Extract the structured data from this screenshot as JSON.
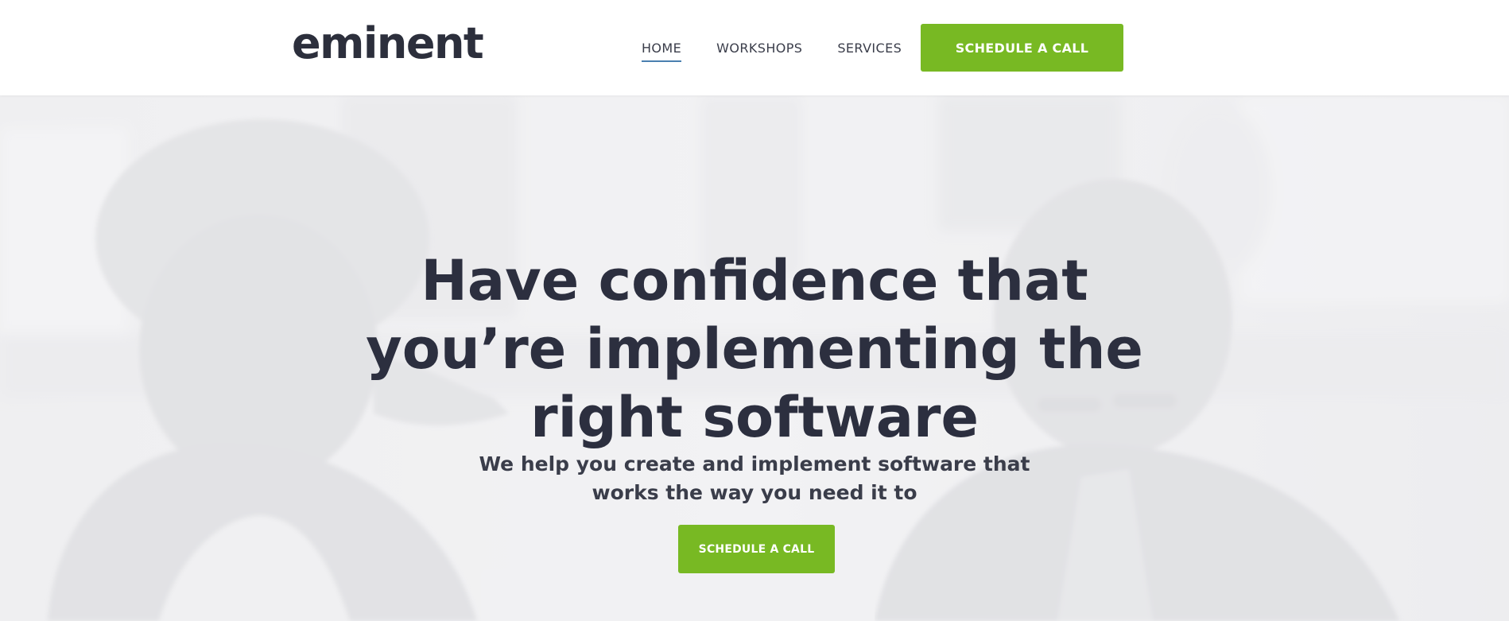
{
  "brand": {
    "logo_text": "eminent"
  },
  "nav": {
    "items": [
      {
        "label": "HOME",
        "active": true
      },
      {
        "label": "WORKSHOPS",
        "active": false
      },
      {
        "label": "SERVICES",
        "active": false
      }
    ],
    "cta_label": "SCHEDULE A CALL"
  },
  "hero": {
    "title_lines": [
      "Have confidence that",
      "you’re implementing the",
      "right software"
    ],
    "subtitle_lines": [
      "We help you create and implement software that",
      "works the way you need it to"
    ],
    "cta_label": "SCHEDULE A CALL"
  },
  "colors": {
    "accent_green": "#78b923",
    "text_dark": "#2c2f3f",
    "nav_underline": "#4a7fb0",
    "hero_bg": "#ebebed"
  }
}
